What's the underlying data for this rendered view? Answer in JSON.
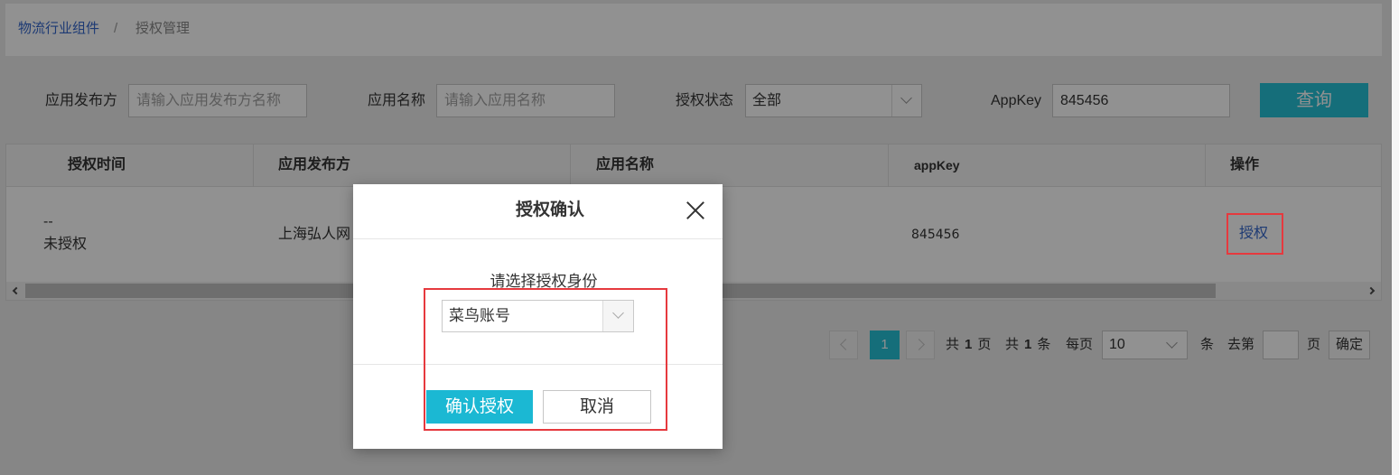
{
  "breadcrumb": {
    "root": "物流行业组件",
    "separator": "/",
    "current": "授权管理"
  },
  "filters": {
    "publisher": {
      "label": "应用发布方",
      "placeholder": "请输入应用发布方名称"
    },
    "app_name": {
      "label": "应用名称",
      "placeholder": "请输入应用名称"
    },
    "auth_status": {
      "label": "授权状态",
      "selected": "全部"
    },
    "appkey": {
      "label": "AppKey",
      "value": "845456"
    },
    "query_button": "查询"
  },
  "table": {
    "headers": [
      "授权时间",
      "应用发布方",
      "应用名称",
      "appKey",
      "操作"
    ],
    "rows": [
      {
        "auth_time": "--",
        "auth_status": "未授权",
        "publisher": "上海弘人网",
        "appkey": "845456",
        "action": "授权"
      }
    ]
  },
  "pagination": {
    "current_page": "1",
    "total_pages_prefix": "共",
    "total_pages": "1",
    "total_pages_suffix": "页",
    "total_items_prefix": "共",
    "total_items": "1",
    "total_items_suffix": "条",
    "per_page_label": "每页",
    "per_page": "10",
    "per_page_suffix": "条",
    "goto_prefix": "去第",
    "goto_suffix": "页",
    "confirm_label": "确定"
  },
  "modal": {
    "title": "授权确认",
    "prompt": "请选择授权身份",
    "identity_selected": "菜鸟账号",
    "confirm_label": "确认授权",
    "cancel_label": "取消"
  },
  "icons": {
    "auth_status_select": "chevron-down-icon",
    "prev_page": "chevron-left-icon",
    "next_page": "chevron-right-icon",
    "per_page_select": "chevron-down-icon",
    "scroll_left": "chevron-left-icon",
    "scroll_right": "chevron-right-icon",
    "modal_close": "close-icon",
    "identity_select": "chevron-down-icon"
  },
  "colors": {
    "accent": "#25c1d6",
    "modal_primary": "#1bb8d3",
    "link": "#3366cc",
    "annotation": "#e6393e",
    "overlay": "rgba(0,0,0,0.43)"
  }
}
